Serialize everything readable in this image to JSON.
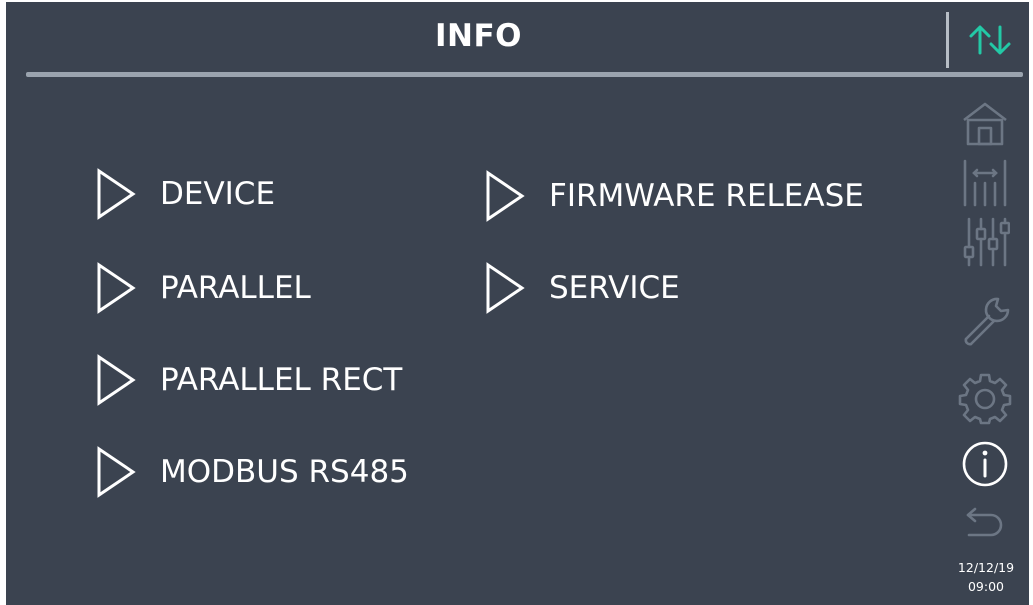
{
  "header": {
    "title": "INFO"
  },
  "colors": {
    "background": "#3b4350",
    "accent": "#23c9a6",
    "text": "#ffffff",
    "inactive_icon": "#6c7684",
    "divider": "#9aa3ae"
  },
  "menu": {
    "items": [
      {
        "label": "DEVICE",
        "icon": "play-triangle-icon"
      },
      {
        "label": "PARALLEL",
        "icon": "play-triangle-icon"
      },
      {
        "label": "PARALLEL RECT",
        "icon": "play-triangle-icon"
      },
      {
        "label": "MODBUS RS485",
        "icon": "play-triangle-icon"
      },
      {
        "label": "FIRMWARE RELEASE",
        "icon": "play-triangle-icon"
      },
      {
        "label": "SERVICE",
        "icon": "play-triangle-icon"
      }
    ]
  },
  "sidebar": {
    "scroll_icon": "up-down-arrows-icon",
    "items": [
      {
        "icon": "home-icon",
        "active": false
      },
      {
        "icon": "measurements-icon",
        "active": false
      },
      {
        "icon": "adjust-sliders-icon",
        "active": false
      },
      {
        "icon": "wrench-icon",
        "active": false
      },
      {
        "icon": "gear-icon",
        "active": false
      },
      {
        "icon": "info-icon",
        "active": true
      },
      {
        "icon": "back-arrow-icon",
        "active": false
      }
    ]
  },
  "status": {
    "date": "12/12/19",
    "time": "09:00"
  }
}
